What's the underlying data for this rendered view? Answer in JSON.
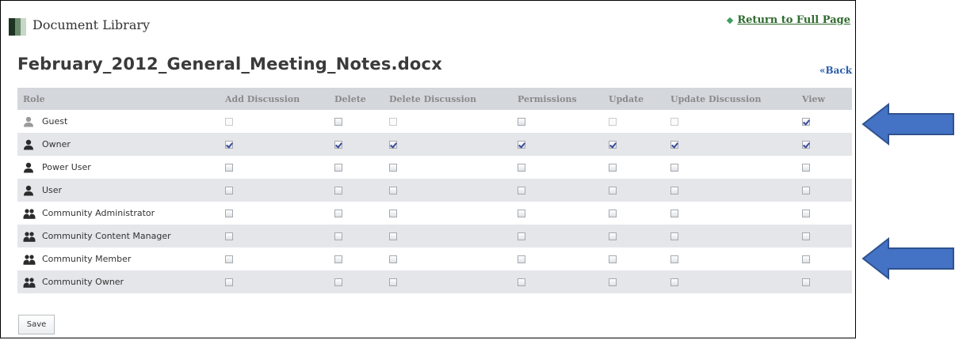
{
  "portlet": {
    "title": "Document Library",
    "return_link": "Return to Full Page"
  },
  "document": {
    "name": "February_2012_General_Meeting_Notes.docx",
    "back_link": "«Back"
  },
  "table": {
    "columns": [
      "Role",
      "Add Discussion",
      "Delete",
      "Delete Discussion",
      "Permissions",
      "Update",
      "Update Discussion",
      "View"
    ],
    "rows": [
      {
        "role": "Guest",
        "icon": "guest-user-icon",
        "values": [
          false,
          false,
          false,
          false,
          false,
          false,
          true
        ],
        "disabled": [
          true,
          false,
          true,
          false,
          true,
          true,
          false
        ]
      },
      {
        "role": "Owner",
        "icon": "user-icon",
        "values": [
          true,
          true,
          true,
          true,
          true,
          true,
          true
        ],
        "disabled": [
          false,
          false,
          false,
          false,
          false,
          false,
          false
        ]
      },
      {
        "role": "Power User",
        "icon": "user-icon",
        "values": [
          false,
          false,
          false,
          false,
          false,
          false,
          false
        ],
        "disabled": [
          false,
          false,
          false,
          false,
          false,
          false,
          false
        ]
      },
      {
        "role": "User",
        "icon": "user-icon",
        "values": [
          false,
          false,
          false,
          false,
          false,
          false,
          false
        ],
        "disabled": [
          false,
          false,
          false,
          false,
          false,
          false,
          false
        ]
      },
      {
        "role": "Community Administrator",
        "icon": "group-icon",
        "values": [
          false,
          false,
          false,
          false,
          false,
          false,
          false
        ],
        "disabled": [
          false,
          false,
          false,
          false,
          false,
          false,
          false
        ]
      },
      {
        "role": "Community Content Manager",
        "icon": "group-icon",
        "values": [
          false,
          false,
          false,
          false,
          false,
          false,
          false
        ],
        "disabled": [
          false,
          false,
          false,
          false,
          false,
          false,
          false
        ]
      },
      {
        "role": "Community Member",
        "icon": "group-icon",
        "values": [
          false,
          false,
          false,
          false,
          false,
          false,
          false
        ],
        "disabled": [
          false,
          false,
          false,
          false,
          false,
          false,
          false
        ]
      },
      {
        "role": "Community Owner",
        "icon": "group-icon",
        "values": [
          false,
          false,
          false,
          false,
          false,
          false,
          false
        ],
        "disabled": [
          false,
          false,
          false,
          false,
          false,
          false,
          false
        ]
      }
    ]
  },
  "actions": {
    "save_label": "Save"
  },
  "colors": {
    "logo": [
      "#1d3322",
      "#6a8a6e",
      "#c9d7c6"
    ],
    "arrow_fill": "#4472c4",
    "arrow_stroke": "#2f528f",
    "icon_dark": "#2b2b2b",
    "icon_light": "#9a9a9a"
  },
  "annotations": [
    {
      "points_to": "Guest"
    },
    {
      "points_to": "Community Member"
    }
  ]
}
